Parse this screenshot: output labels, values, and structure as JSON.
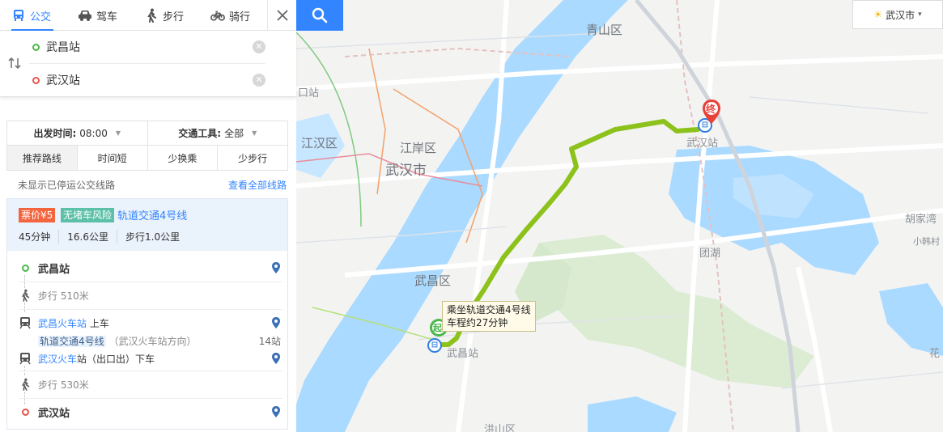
{
  "modes": [
    {
      "label": "公交",
      "icon": "bus-icon",
      "active": true
    },
    {
      "label": "驾车",
      "icon": "car-icon",
      "active": false
    },
    {
      "label": "步行",
      "icon": "walk-icon",
      "active": false
    },
    {
      "label": "骑行",
      "icon": "bike-icon",
      "active": false
    }
  ],
  "origin": "武昌站",
  "destination": "武汉站",
  "filters": {
    "depart_label": "出发时间:",
    "depart_value": "08:00",
    "tool_label": "交通工具:",
    "tool_value": "全部",
    "tabs": [
      "推荐路线",
      "时间短",
      "少换乘",
      "少步行"
    ],
    "active_tab": 0
  },
  "notice": {
    "text": "未显示已停运公交线路",
    "link": "查看全部线路"
  },
  "route": {
    "price_tag": "票价¥5",
    "traffic_tag": "无堵车风险",
    "line_name": "轨道交通4号线",
    "duration": "45分钟",
    "distance": "16.6公里",
    "walk": "步行1.0公里",
    "steps": {
      "start_name": "武昌站",
      "walk1": "步行",
      "walk1_dist": "510米",
      "board_station": "武昌火车站",
      "board_action": "上车",
      "line_chip": "轨道交通4号线",
      "line_dir": "（武汉火车站方向）",
      "stops": "14站",
      "alight_station": "武汉火车",
      "alight_suffix": "站（出口出）下车",
      "walk2": "步行",
      "walk2_dist": "530米",
      "end_name": "武汉站"
    }
  },
  "map": {
    "city": "武汉市",
    "tooltip_line1": "乘坐轨道交通4号线",
    "tooltip_line2": "车程约27分钟",
    "start_pin": "起",
    "end_pin": "终",
    "bus_glyph": "⊟",
    "labels": {
      "qingshan": "青山区",
      "jiang_an": "江岸区",
      "jianghan": "江汉区",
      "wuhan_city": "武汉市",
      "wuchang": "武昌区",
      "hongshan": "洪山区",
      "wuchang_station": "武昌站",
      "wuhan_station": "武汉站",
      "tuanhu": "团湖",
      "hujiawan": "胡家湾",
      "xiaohancun": "小韩村",
      "kou_zhan": "口站",
      "hua": "花"
    },
    "colors": {
      "water": "#aadaff",
      "route": "#8cc21b",
      "green": "#cfe8c2",
      "road": "#ffffff",
      "accent": "#3385ff"
    }
  }
}
